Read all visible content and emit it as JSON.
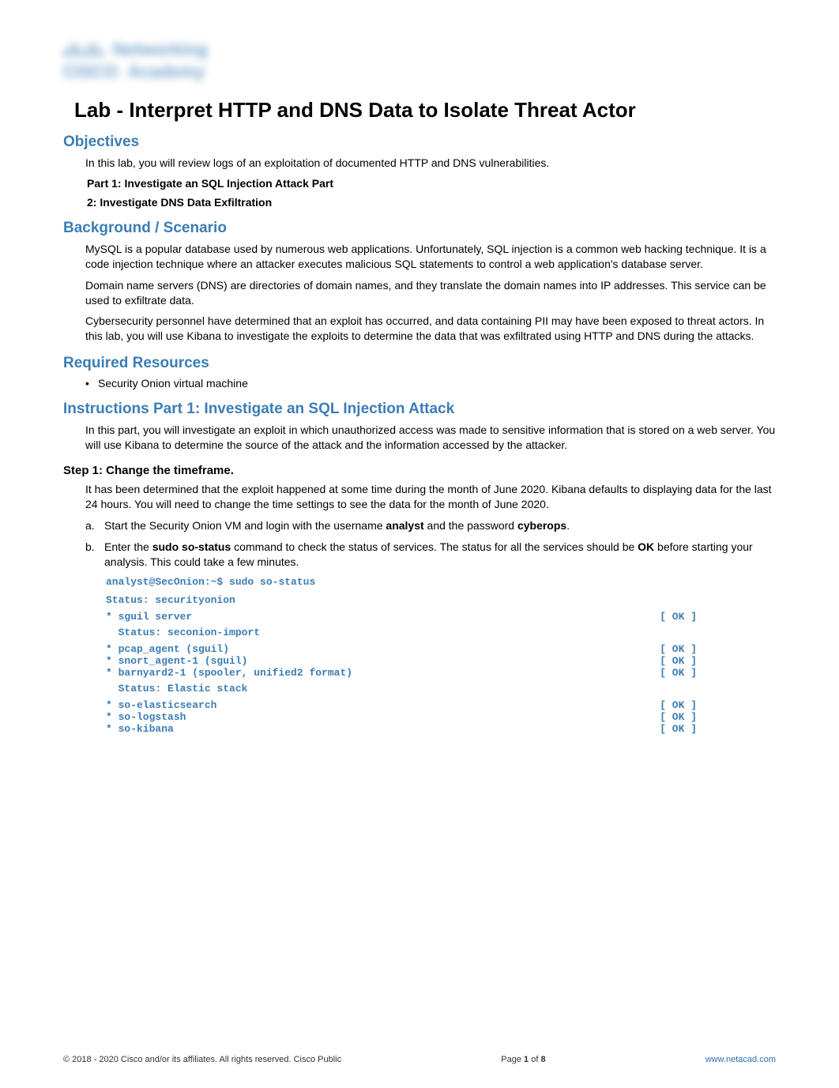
{
  "logo": {
    "line1": "Networking",
    "line2_left": "CISCO",
    "line2_right": "Academy"
  },
  "title": "Lab - Interpret HTTP and DNS Data to Isolate Threat Actor",
  "sections": {
    "objectives": {
      "heading": "Objectives",
      "intro": "In this lab, you will review logs of an exploitation of documented HTTP and DNS vulnerabilities.",
      "part1": "Part 1: Investigate an SQL Injection Attack Part",
      "part2": "2: Investigate DNS Data Exfiltration"
    },
    "background": {
      "heading": "Background / Scenario",
      "p1": "MySQL is a popular database used by numerous web applications. Unfortunately, SQL injection is a common web hacking technique. It is a code injection technique where an attacker executes malicious SQL statements to control a web application's database server.",
      "p2": "Domain name servers (DNS) are directories of domain names, and they translate the domain names into IP addresses. This service can be used to exfiltrate data.",
      "p3": "Cybersecurity personnel have determined that an exploit has occurred, and data containing PII may have been exposed to threat actors. In this lab, you will use Kibana to investigate the exploits to determine the data that was exfiltrated using HTTP and DNS during the attacks."
    },
    "resources": {
      "heading": "Required Resources",
      "item1": "Security Onion virtual machine"
    },
    "instructions": {
      "heading": "Instructions Part 1: Investigate an SQL Injection Attack",
      "intro": "In this part, you will investigate an exploit in which unauthorized access was made to sensitive information that is stored on a web server. You will use Kibana to determine the source of the attack and the information accessed by the attacker."
    },
    "step1": {
      "heading": "Step 1: Change the timeframe.",
      "intro": "It has been determined that the exploit happened at some time during the month of June 2020. Kibana defaults to displaying data for the last 24 hours. You will need to change the time settings to see the data for the month of June 2020.",
      "a_pre": "Start the Security Onion VM and login with the username ",
      "a_user": "analyst",
      "a_mid": " and the password ",
      "a_pass": "cyberops",
      "a_end": ".",
      "b_pre": "Enter the ",
      "b_cmd": "sudo so-status",
      "b_mid": " command to check the status of services. The status for all the services should be ",
      "b_ok": "OK",
      "b_end": " before starting your analysis. This could take a few minutes."
    },
    "code": {
      "prompt": "analyst@SecOnion:~$ ",
      "cmd": "sudo so-status",
      "l1": "Status: securityonion",
      "l2": "* sguil server",
      "l2s": "[  OK  ]",
      "l3": "  Status: seconion-import",
      "l4": "* pcap_agent (sguil)",
      "l4s": "[  OK  ]",
      "l5": "* snort_agent-1 (sguil)",
      "l5s": "[  OK  ]",
      "l6": "  * barnyard2-1 (spooler, unified2 format)",
      "l6s": "[  OK  ]",
      "l7": "  Status: Elastic stack",
      "l8": "* so-elasticsearch",
      "l8s": "[  OK  ]",
      "l9": "* so-logstash",
      "l9s": "[  OK  ]",
      "l10": "* so-kibana",
      "l10s": "[  OK  ]"
    }
  },
  "footer": {
    "copyright": "© 2018 - 2020 Cisco and/or its affiliates. All rights reserved. Cisco Public",
    "page": "Page 1 of 8",
    "link": "www.netacad.com"
  }
}
